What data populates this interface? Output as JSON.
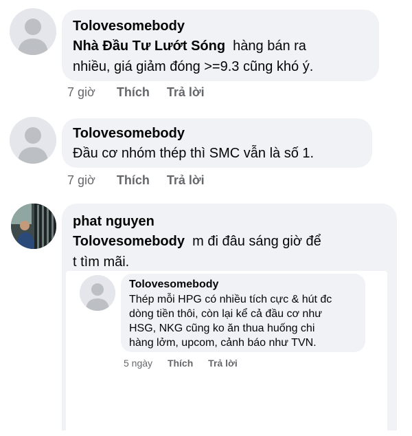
{
  "comments": [
    {
      "author": "Tolovesomebody",
      "mention": "Nhà Đầu Tư Lướt Sóng",
      "text_line1": "  hàng bán ra",
      "text_line2": "nhiều, giá giảm đóng >=9.3 cũng khó ý.",
      "time": "7 giờ",
      "like": "Thích",
      "reply": "Trả lời"
    },
    {
      "author": "Tolovesomebody",
      "text_line1": "Đầu cơ nhóm thép thì SMC vẫn là số 1.",
      "time": "7 giờ",
      "like": "Thích",
      "reply": "Trả lời"
    },
    {
      "author": "phat nguyen",
      "mention": "Tolovesomebody",
      "text_line1": "  m đi đâu sáng giờ để",
      "text_line2": "t tìm mãi."
    }
  ],
  "nested": {
    "author": "Tolovesomebody",
    "lines": [
      "Thép mỗi HPG có nhiều tích cực & hút đc",
      "dòng tiền thôi, còn lại kể cả đầu cơ như",
      "HSG, NKG cũng ko ăn thua huống chi",
      "hàng lởm, upcom, cảnh báo như TVN."
    ],
    "time": "5 ngày",
    "like": "Thích",
    "reply": "Trả lời"
  },
  "icons": {
    "default_avatar": "user-silhouette-icon",
    "photo_avatar": "user-photo-avatar"
  }
}
